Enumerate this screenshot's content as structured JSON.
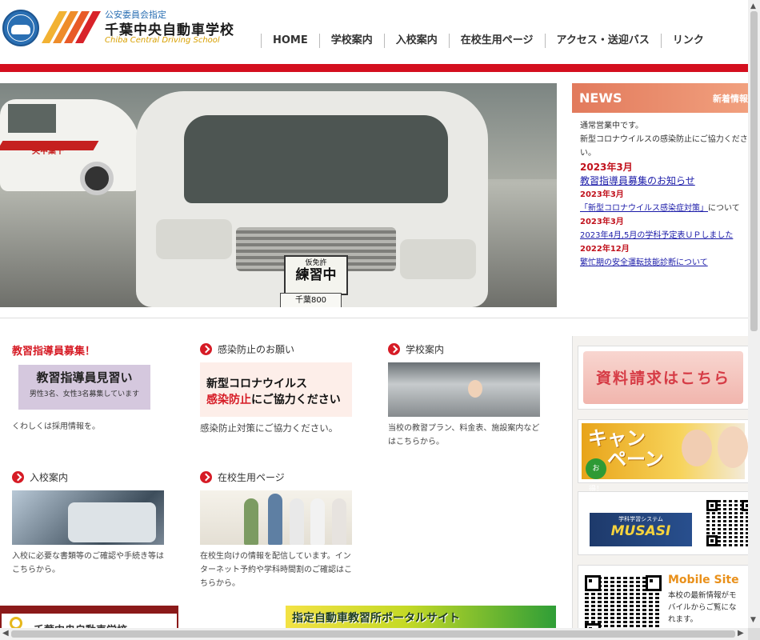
{
  "header": {
    "sub": "公安委員会指定",
    "title": "千葉中央自動車学校",
    "title_en": "Chiba Central Driving School",
    "nav": [
      "HOME",
      "学校案内",
      "入校案内",
      "在校生用ページ",
      "アクセス・送迎バス",
      "リンク"
    ]
  },
  "hero": {
    "plate_top": "仮免許",
    "plate_main": "練習中",
    "plate_number": "千葉800",
    "car_label": "央中葉千"
  },
  "news": {
    "title": "NEWS",
    "subtitle": "新着情報",
    "intro1": "通常営業中です。",
    "intro2": "新型コロナウイルスの感染防止にご協力ください。",
    "items": [
      {
        "date": "2023年3月",
        "text": "教習指導員募集のお知らせ"
      },
      {
        "date": "2023年3月",
        "text": "「新型コロナウイルス感染症対策」",
        "suffix": "について"
      },
      {
        "date": "2023年3月",
        "text": "2023年4月,5月の学科予定表ＵＰしました"
      },
      {
        "date": "2022年12月",
        "text": "繁忙期の安全運転技能診断について"
      }
    ]
  },
  "cards": {
    "recruit": {
      "title": "教習指導員募集！",
      "banner_line1": "教習指導員見習い",
      "banner_line2": "男性3名、女性3名募集しています",
      "desc": "くわしくは採用情報を。"
    },
    "covid": {
      "title": "感染防止のお願い",
      "banner_line1": "新型コロナウイルス",
      "banner_red": "感染防止",
      "banner_rest": "にご協力ください",
      "desc": "感染防止対策にご協力ください。"
    },
    "school": {
      "title": "学校案内",
      "desc": "当校の教習プラン、料金表、施設案内などはこちらから。"
    },
    "enroll": {
      "title": "入校案内",
      "desc": "入校に必要な書類等のご確認や手続き等はこちらから。"
    },
    "students": {
      "title": "在校生用ページ",
      "desc": "在校生向けの情報を配信しています。インターネット予約や学科時間割のご確認はこちらから。"
    }
  },
  "sidebar": {
    "request": "資料請求はこちら",
    "campaign_line1": "キャン",
    "campaign_line2": "ペーン",
    "campaign_badge": "お得！",
    "musasi_small": "学科学習システム",
    "musasi_big": "MUSASI",
    "mobile_title": "Mobile Site",
    "mobile_text": "本校の最新情報がモバイルからご覧になれます。"
  },
  "bottom": {
    "left_text": "千葉中央自動車学校",
    "portal_text": "指定自動車教習所ポータルサイト"
  },
  "colors": {
    "accent_red": "#d40f1f",
    "news_header": "#e27a5c",
    "link_blue": "#1a1aa8"
  }
}
